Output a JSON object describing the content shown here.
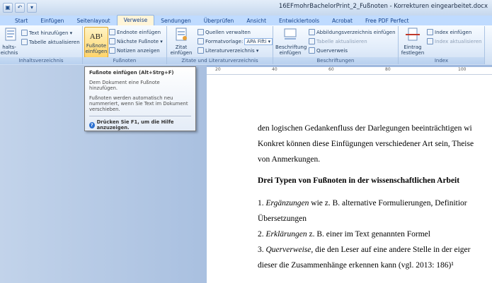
{
  "window": {
    "title": "16EFmohrBachelorPrint_2_Fußnoten - Korrekturen eingearbeitet.docx"
  },
  "qat": {
    "save_icon": "save-icon",
    "undo_icon": "undo-icon"
  },
  "tabs": [
    {
      "label": "Start"
    },
    {
      "label": "Einfügen"
    },
    {
      "label": "Seitenlayout"
    },
    {
      "label": "Verweise",
      "active": true
    },
    {
      "label": "Sendungen"
    },
    {
      "label": "Überprüfen"
    },
    {
      "label": "Ansicht"
    },
    {
      "label": "Entwicklertools"
    },
    {
      "label": "Acrobat"
    },
    {
      "label": "Free PDF Perfect"
    }
  ],
  "ribbon": {
    "toc": {
      "label": "Inhaltsverzeichnis",
      "big_label_1": "halts-",
      "big_label_2": "eichnis ▾",
      "add_text": "Text hinzufügen ▾",
      "update_table": "Tabelle aktualisieren"
    },
    "footnotes": {
      "label": "Fußnoten",
      "insert_footnote_1": "Fußnote",
      "insert_footnote_2": "einfügen",
      "insert_endnote": "Endnote einfügen",
      "next_footnote": "Nächste Fußnote ▾",
      "show_notes": "Notizen anzeigen",
      "ab_glyph": "AB¹"
    },
    "citations": {
      "label": "Zitate und Literaturverzeichnis",
      "insert_citation_1": "Zitat",
      "insert_citation_2": "einfügen ▾",
      "manage_sources": "Quellen verwalten",
      "style_label": "Formatvorlage:",
      "style_value": "APA Fifti ▾",
      "bibliography": "Literaturverzeichnis ▾"
    },
    "captions": {
      "label": "Beschriftungen",
      "insert_caption_1": "Beschriftung",
      "insert_caption_2": "einfügen",
      "insert_tof": "Abbildungsverzeichnis einfügen",
      "update_table": "Tabelle aktualisieren",
      "cross_ref": "Querverweis"
    },
    "index": {
      "label": "Index",
      "mark_entry_1": "Eintrag",
      "mark_entry_2": "festlegen",
      "insert_index": "Index einfügen",
      "update_index": "Index aktualisieren"
    }
  },
  "tooltip": {
    "title": "Fußnote einfügen (Alt+Strg+F)",
    "p1_line1": "Dem Dokument eine Fußnote",
    "p1_line2": "hinzufügen.",
    "p2_line1": "Fußnoten werden automatisch neu",
    "p2_line2": "nummeriert, wenn Sie Text im Dokument",
    "p2_line3": "verschieben.",
    "help": "Drücken Sie F1, um die Hilfe anzuzeigen."
  },
  "ruler": {
    "ticks": [
      "20",
      "40",
      "60",
      "80",
      "100"
    ]
  },
  "document": {
    "line1": "den logischen Gedankenfluss der Darlegungen beeinträchtigen wi",
    "line2": "Konkret können diese Einfügungen verschiedener Art sein, Theise",
    "line3": "von Anmerkungen.",
    "heading": "Drei Typen von Fußnoten in der wissenschaftlichen Arbeit",
    "item1_num": "1.",
    "item1_em": "Ergänzungen",
    "item1_rest": " wie z. B. alternative Formulierungen, Definitior",
    "item1_cont": "Übersetzungen",
    "item2_num": "2.",
    "item2_em": "Erklärungen",
    "item2_rest": " z. B. einer im Text genannten Formel",
    "item3_num": "3.",
    "item3_em": "Querverweise,",
    "item3_rest": " die den Leser auf eine andere Stelle in der eiger",
    "item3_cont": "dieser die Zusammenhänge erkennen kann (vgl. 2013: 186)¹"
  }
}
